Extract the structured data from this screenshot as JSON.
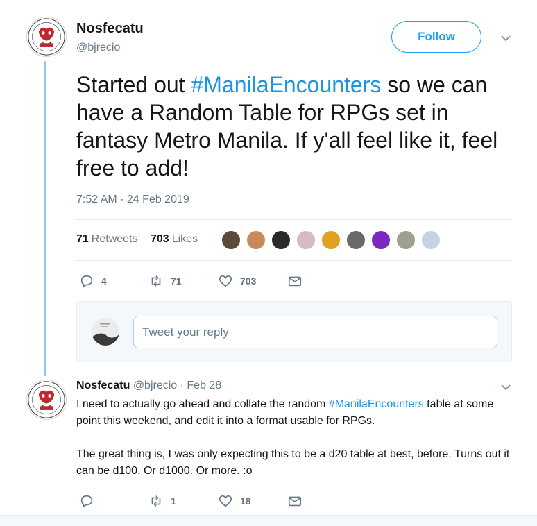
{
  "tweet": {
    "author_name": "Nosfecatu",
    "author_handle": "@bjrecio",
    "follow_label": "Follow",
    "text_before": "Started out ",
    "hashtag": "#ManilaEncounters",
    "text_after": " so we can have a Random Table for RPGs set in fantasy Metro Manila. If y'all feel like it, feel free to add!",
    "timestamp": "7:52 AM - 24 Feb 2019",
    "retweets_count": "71",
    "retweets_label": "Retweets",
    "likes_count": "703",
    "likes_label": "Likes",
    "actions": {
      "replies": "4",
      "retweets": "71",
      "likes": "703"
    }
  },
  "reply_box": {
    "placeholder": "Tweet your reply"
  },
  "reply": {
    "author_name": "Nosfecatu",
    "author_handle": "@bjrecio",
    "separator": " · ",
    "date": "Feb 28",
    "line1_before": "I need to actually go ahead and collate the random ",
    "hashtag": "#ManilaEncounters",
    "line1_after": " table at some point this weekend, and edit it into a format usable for RPGs.",
    "paragraph2": "The great thing is, I was only expecting this to be a d20 table at best, before. Turns out it can be d100. Or d1000. Or more. :o",
    "actions": {
      "replies": "",
      "retweets": "1",
      "likes": "18"
    }
  },
  "likers_colors": [
    "#5b4a3a",
    "#c98a5a",
    "#2a2a2a",
    "#d9b8c8",
    "#e0a020",
    "#6a6a6a",
    "#7a2ac0",
    "#a0a090",
    "#c8d0e8"
  ],
  "colors": {
    "accent": "#1da1f2",
    "link": "#1b95e0",
    "muted": "#657786",
    "thread_line": "#9ac2f0"
  },
  "icons": [
    "reply-icon",
    "retweet-icon",
    "like-icon",
    "message-icon",
    "chevron-down-icon"
  ]
}
